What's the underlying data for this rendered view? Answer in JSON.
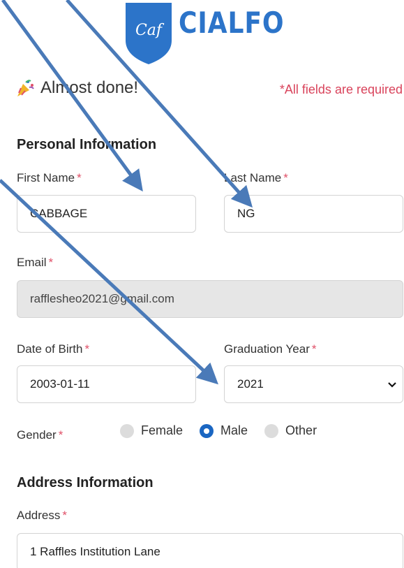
{
  "brand": {
    "name": "CIALFO",
    "shield_text": "Caf",
    "color": "#2c74c9"
  },
  "header": {
    "intro": "Almost done!",
    "required_note": "*All fields are required"
  },
  "personal": {
    "title": "Personal Information",
    "first_name": {
      "label": "First Name",
      "value": "CABBAGE"
    },
    "last_name": {
      "label": "Last Name",
      "value": "NG"
    },
    "email": {
      "label": "Email",
      "value": "rafflesheo2021@gmail.com"
    },
    "dob": {
      "label": "Date of Birth",
      "value": "2003-01-11"
    },
    "grad_year": {
      "label": "Graduation Year",
      "value": "2021"
    },
    "gender": {
      "label": "Gender",
      "options": [
        "Female",
        "Male",
        "Other"
      ],
      "selected": "Male"
    }
  },
  "address": {
    "title": "Address Information",
    "address": {
      "label": "Address",
      "value": "1 Raffles Institution Lane"
    }
  },
  "required_star": "*",
  "colors": {
    "accent": "#1a66c2",
    "required": "#d9435b",
    "annotation_arrow": "#4a7ab8"
  }
}
